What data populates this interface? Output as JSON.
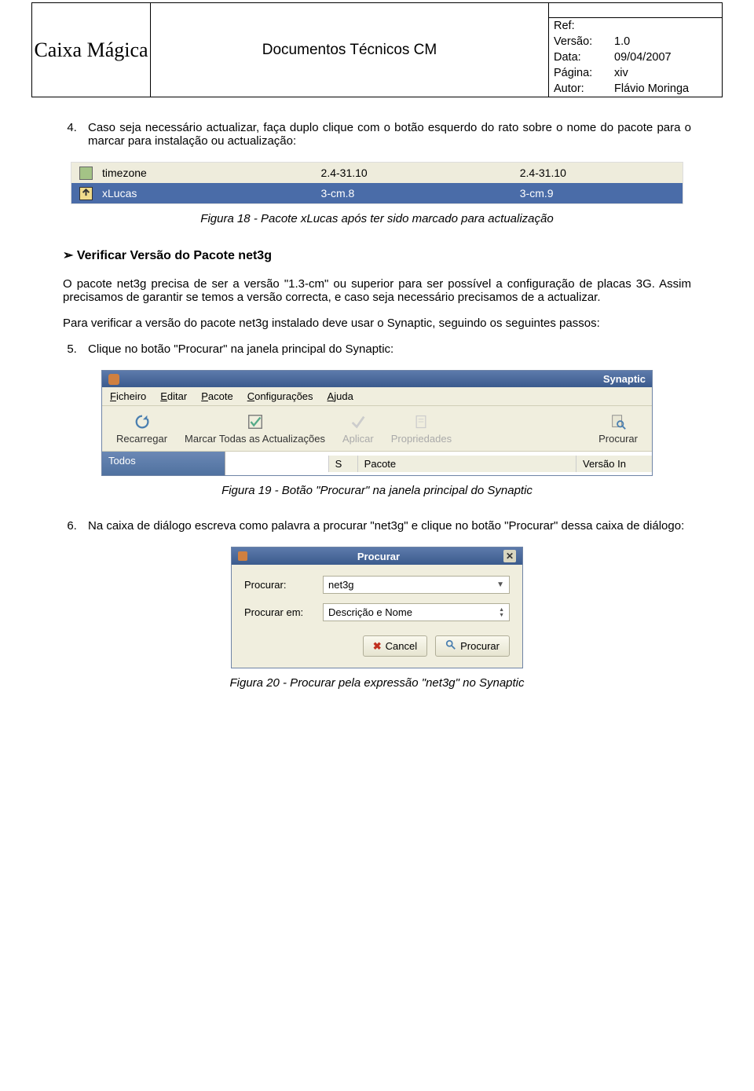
{
  "header": {
    "org": "Caixa Mágica",
    "title": "Documentos Técnicos CM",
    "ref_label": "Ref:",
    "ref_value": "",
    "version_label": "Versão:",
    "version_value": "1.0",
    "date_label": "Data:",
    "date_value": "09/04/2007",
    "page_label": "Página:",
    "page_value": "xiv",
    "author_label": "Autor:",
    "author_value": "Flávio Moringa"
  },
  "step4": "Caso seja necessário actualizar, faça duplo clique com o botão esquerdo do rato sobre o nome do pacote para o marcar para instalação ou actualização:",
  "ss1": {
    "rows": [
      {
        "name": "timezone",
        "v1": "2.4-31.10",
        "v2": "2.4-31.10"
      },
      {
        "name": "xLucas",
        "v1": "3-cm.8",
        "v2": "3-cm.9"
      }
    ]
  },
  "caption18": "Figura 18 - Pacote xLucas após ter sido marcado para actualização",
  "section_heading": "Verificar Versão do Pacote net3g",
  "para1": "O pacote net3g precisa de ser a versão \"1.3-cm\" ou superior para ser possível a configuração de placas 3G. Assim precisamos de garantir se temos a versão correcta, e caso seja necessário precisamos de a actualizar.",
  "para2": "Para verificar a versão do pacote net3g instalado deve usar o Synaptic, seguindo os seguintes passos:",
  "step5": "Clique no botão \"Procurar\" na janela principal do Synaptic:",
  "ss2": {
    "title": "Synaptic",
    "menu": [
      "Ficheiro",
      "Editar",
      "Pacote",
      "Configurações",
      "Ajuda"
    ],
    "toolbar": {
      "reload": "Recarregar",
      "mark": "Marcar Todas as Actualizações",
      "apply": "Aplicar",
      "props": "Propriedades",
      "search": "Procurar"
    },
    "left_label": "Todos",
    "col_s": "S",
    "col_pkg": "Pacote",
    "col_ver": "Versão In"
  },
  "caption19": "Figura 19 - Botão \"Procurar\" na janela principal do Synaptic",
  "step6": "Na caixa de diálogo escreva como palavra a procurar \"net3g\" e clique no botão \"Procurar\" dessa caixa de diálogo:",
  "ss3": {
    "title": "Procurar",
    "label1": "Procurar:",
    "value1": "net3g",
    "label2": "Procurar em:",
    "value2": "Descrição e Nome",
    "cancel": "Cancel",
    "search": "Procurar"
  },
  "caption20": "Figura 20 - Procurar pela expressão \"net3g\" no Synaptic"
}
